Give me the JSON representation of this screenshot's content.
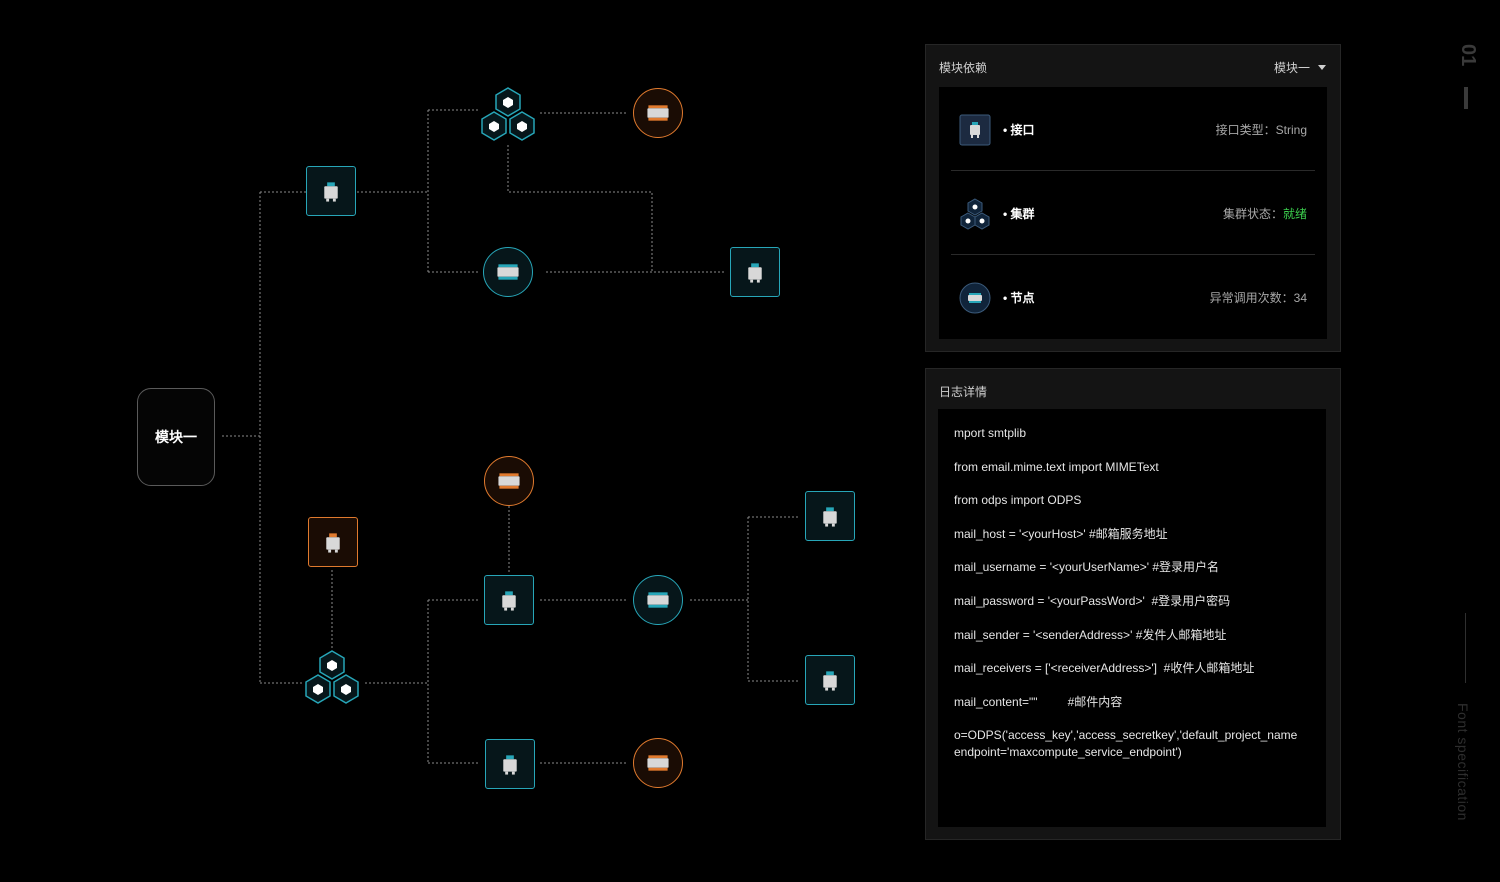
{
  "colors": {
    "teal": "#27a6b8",
    "orange": "#e07a2e",
    "ready_green": "#3ccf4e"
  },
  "graph": {
    "root_label": "模块一"
  },
  "dependency_panel": {
    "title": "模块依赖",
    "selector": "模块一",
    "items": [
      {
        "icon": "interface-icon",
        "label": "• 接口",
        "meta_label": "接口类型：",
        "meta_value": "String"
      },
      {
        "icon": "cluster-icon",
        "label": "• 集群",
        "meta_label": "集群状态：",
        "meta_value": "就绪"
      },
      {
        "icon": "node-icon",
        "label": "• 节点",
        "meta_label": "异常调用次数：",
        "meta_value": "34"
      }
    ]
  },
  "log_panel": {
    "title": "日志详情",
    "lines": [
      "mport smtplib",
      "from email.mime.text import MIMEText",
      "from odps import ODPS",
      "mail_host = '<yourHost>' #邮箱服务地址",
      "mail_username = '<yourUserName>' #登录用户名",
      "mail_password = '<yourPassWord>'  #登录用户密码",
      "mail_sender = '<senderAddress>' #发件人邮箱地址",
      "mail_receivers = ['<receiverAddress>']  #收件人邮箱地址",
      "mail_content=\"\"         #邮件内容",
      "o=ODPS('access_key','access_secretkey','default_project_name\nendpoint='maxcompute_service_endpoint')"
    ]
  },
  "side": {
    "page_number": "01",
    "caption": "Font specification"
  }
}
